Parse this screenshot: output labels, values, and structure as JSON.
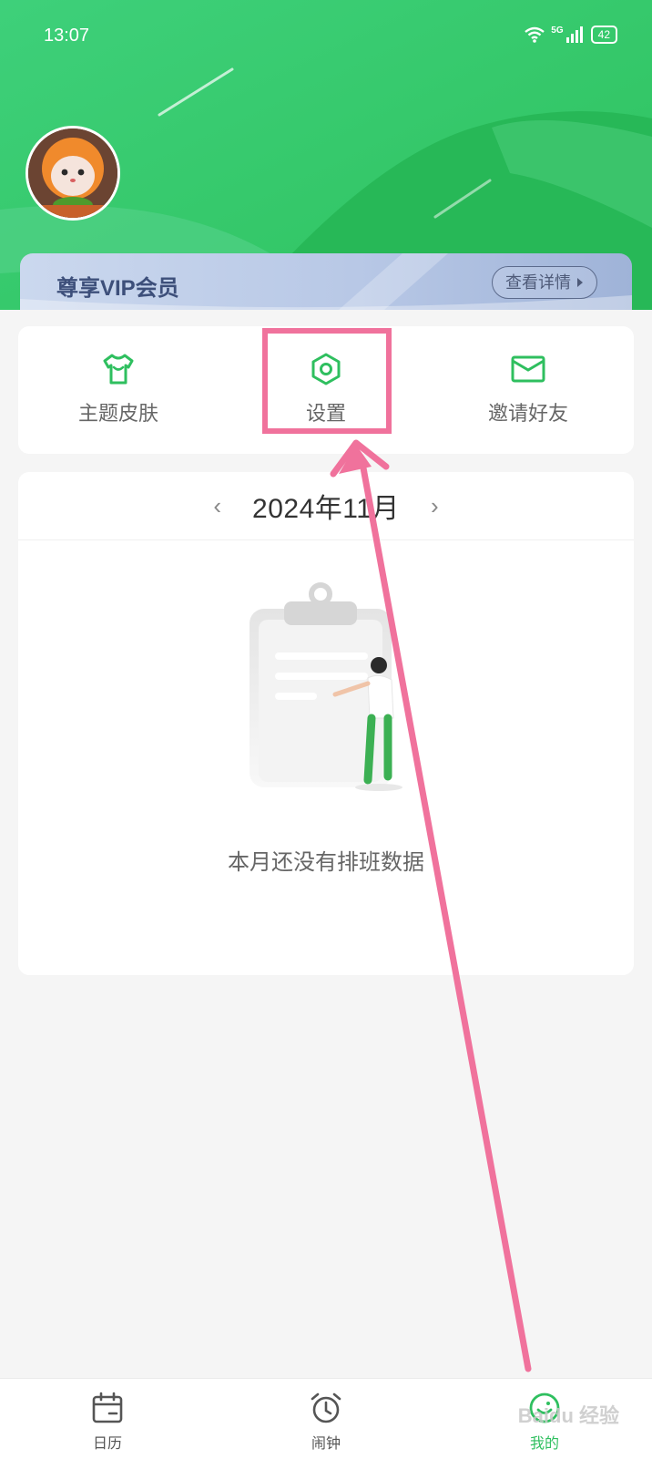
{
  "status_bar": {
    "time": "13:07",
    "network": "5G",
    "battery": "42"
  },
  "profile": {
    "avatar_icon": "cartoon-avatar-icon"
  },
  "vip": {
    "title": "尊享VIP会员",
    "detail_button": "查看详情"
  },
  "actions": [
    {
      "label": "主题皮肤",
      "icon": "shirt-icon"
    },
    {
      "label": "设置",
      "icon": "settings-hexagon-icon"
    },
    {
      "label": "邀请好友",
      "icon": "envelope-icon"
    }
  ],
  "calendar": {
    "month": "2024年11月",
    "empty_text": "本月还没有排班数据"
  },
  "nav": {
    "items": [
      {
        "label": "日历",
        "icon": "calendar-icon"
      },
      {
        "label": "闹钟",
        "icon": "alarm-clock-icon"
      },
      {
        "label": "我的",
        "icon": "smile-face-icon"
      }
    ],
    "active": 2
  },
  "colors": {
    "brand_green": "#2fbf5f",
    "highlight_pink": "#f0729c",
    "vip_text": "#3d4f7a"
  },
  "watermark": "Baidu 经验"
}
